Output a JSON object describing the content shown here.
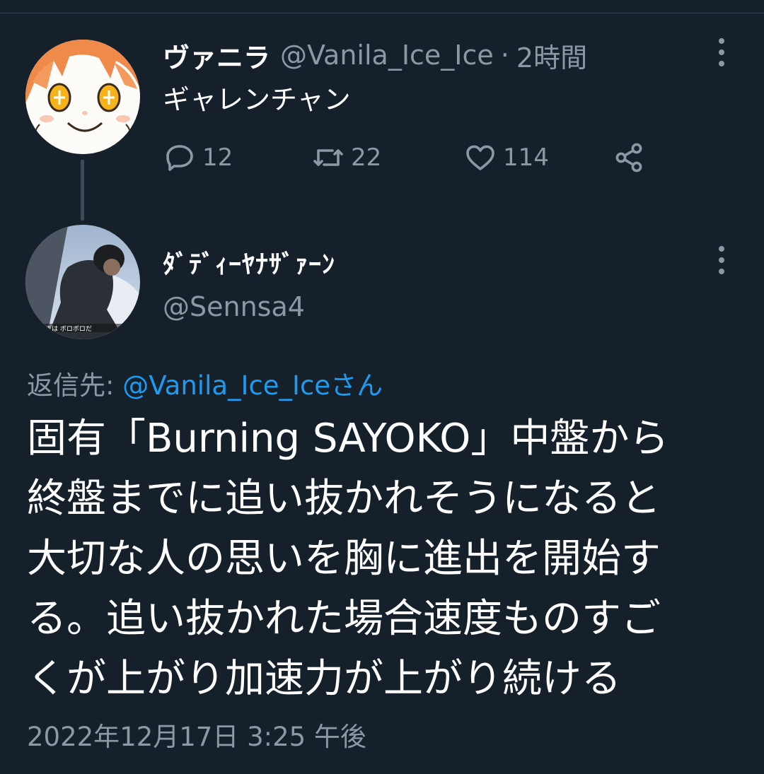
{
  "parent_tweet": {
    "display_name": "ヴァニラ",
    "handle": "@Vanila_Ice_Ice",
    "separator": "·",
    "time_ago": "2時間",
    "text": "ギャレンチャン",
    "actions": {
      "reply_count": "12",
      "retweet_count": "22",
      "like_count": "114"
    }
  },
  "main_tweet": {
    "display_name": "ﾀﾞﾃﾞｨｰﾔﾅｻﾞｧｰﾝ",
    "handle": "@Sennsa4",
    "reply_prefix": "返信先: ",
    "reply_mention": "@Vanila_Ice_Iceさん",
    "body_lines": [
      "固有「Burning SAYOKO」中盤から",
      "終盤までに追い抜かれそうになると",
      "大切な人の思いを胸に進出を開始す",
      "る。追い抜かれた場合速度ものすご",
      "くが上がり加速力が上がり続ける"
    ],
    "timestamp": "2022年12月17日 3:25 午後"
  },
  "colors": {
    "background": "#15202b",
    "secondary_text": "#8b98a5",
    "accent": "#1d9bf0"
  },
  "icons": {
    "reply": "speech-bubble-icon",
    "retweet": "retweet-icon",
    "like": "heart-icon",
    "share": "share-icon",
    "more": "more-vertical-icon"
  }
}
